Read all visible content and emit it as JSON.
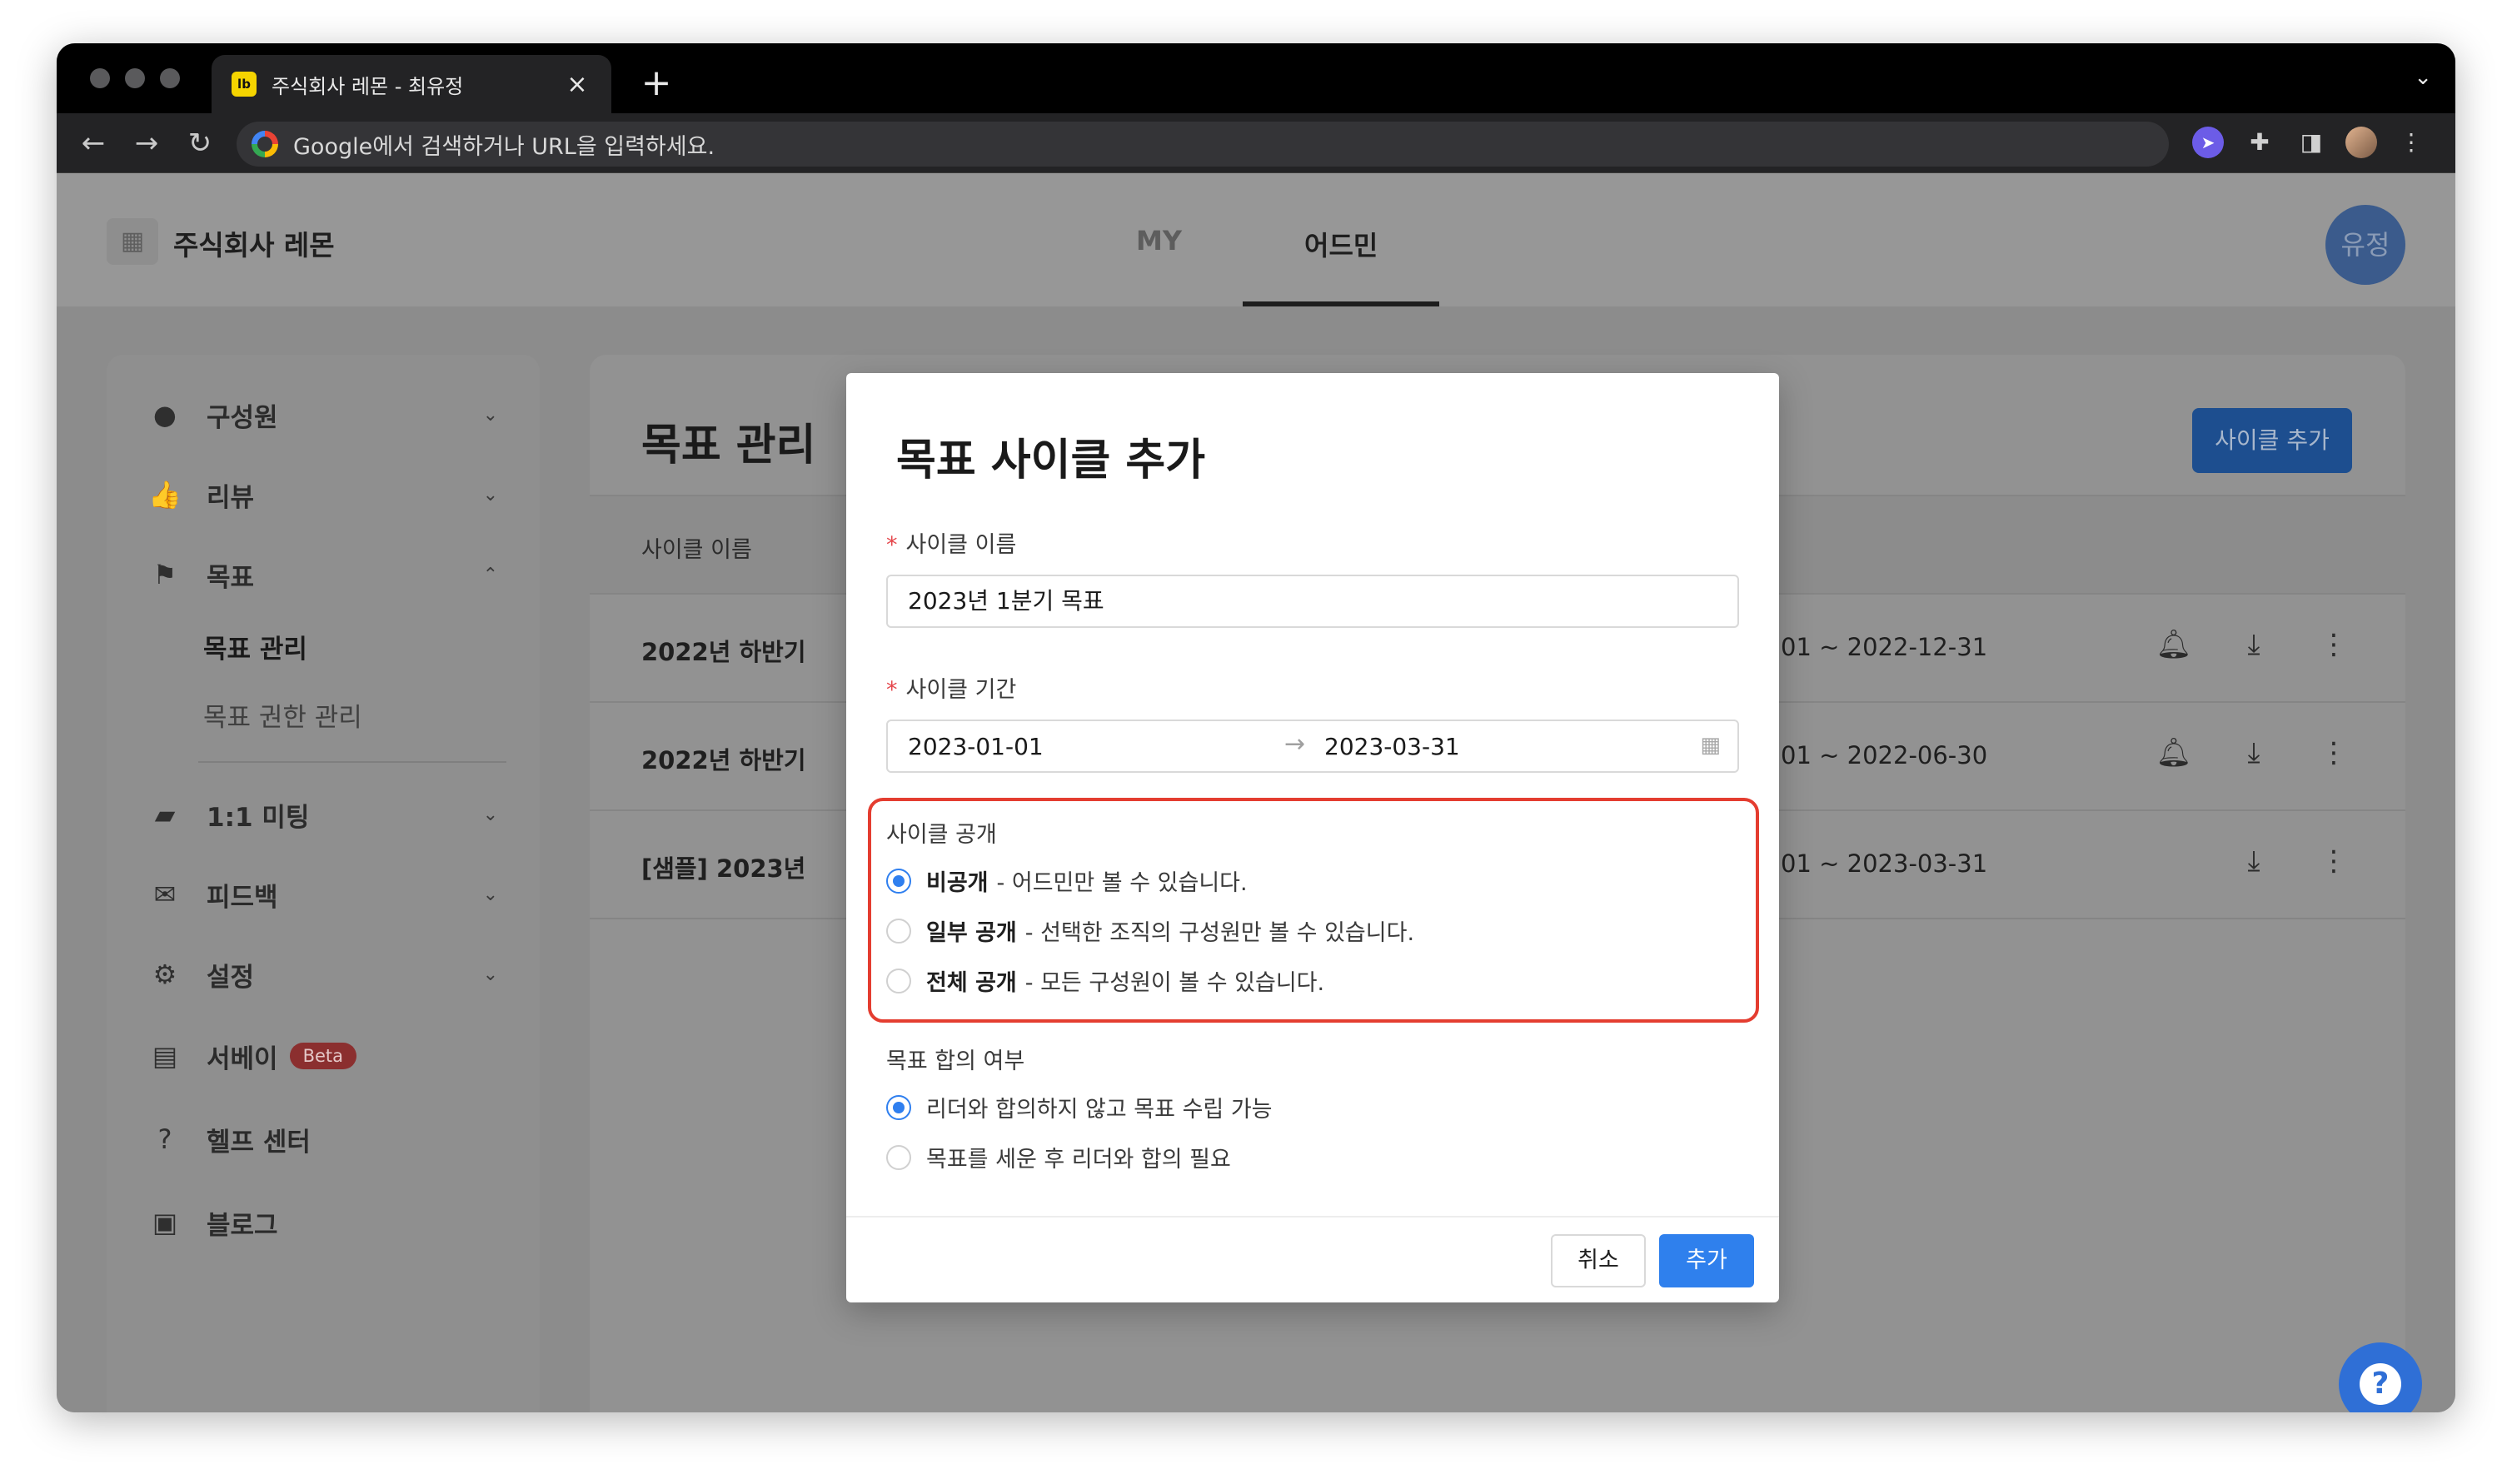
{
  "browser": {
    "tab_title": "주식회사 레몬 - 최유정",
    "tab_favicon": "lb",
    "omnibox_placeholder": "Google에서 검색하거나 URL을 입력하세요."
  },
  "header": {
    "company_name": "주식회사 레몬",
    "tabs": [
      {
        "label": "MY",
        "active": false
      },
      {
        "label": "어드민",
        "active": true
      }
    ],
    "user_avatar": "유정"
  },
  "sidebar": {
    "items": [
      {
        "label": "구성원",
        "icon": "person-icon",
        "expanded": false
      },
      {
        "label": "리뷰",
        "icon": "thumbs-up-icon",
        "expanded": false
      },
      {
        "label": "목표",
        "icon": "flag-icon",
        "expanded": true
      },
      {
        "label": "1:1 미팅",
        "icon": "chat-icon",
        "expanded": false
      },
      {
        "label": "피드백",
        "icon": "mail-icon",
        "expanded": false
      },
      {
        "label": "설정",
        "icon": "gear-icon",
        "expanded": false
      },
      {
        "label": "서베이",
        "icon": "document-icon",
        "badge": "Beta"
      },
      {
        "label": "헬프 센터",
        "icon": "help-icon"
      },
      {
        "label": "블로그",
        "icon": "book-icon"
      }
    ],
    "sub_items": [
      {
        "label": "목표 관리",
        "active": true
      },
      {
        "label": "목표 권한 관리",
        "active": false
      }
    ]
  },
  "main": {
    "title": "목표 관리",
    "add_button": "사이클 추가",
    "column_name": "사이클 이름",
    "rows": [
      {
        "name": "2022년 하반기",
        "date": "01 ~ 2022-12-31",
        "has_bell": true
      },
      {
        "name": "2022년 하반기",
        "date": "01 ~ 2022-06-30",
        "has_bell": true
      },
      {
        "name": "[샘플] 2023년",
        "date": "01 ~ 2023-03-31",
        "has_bell": false
      }
    ]
  },
  "modal": {
    "title": "목표 사이클 추가",
    "required_mark": "*",
    "name_label": "사이클 이름",
    "name_value": "2023년 1분기 목표",
    "period_label": "사이클 기간",
    "period_start": "2023-01-01",
    "period_end": "2023-03-31",
    "visibility_label": "사이클 공개",
    "visibility_options": [
      {
        "title": "비공개",
        "desc": "- 어드민만 볼 수 있습니다.",
        "selected": true
      },
      {
        "title": "일부 공개",
        "desc": "- 선택한 조직의 구성원만 볼 수 있습니다.",
        "selected": false
      },
      {
        "title": "전체 공개",
        "desc": "- 모든 구성원이 볼 수 있습니다.",
        "selected": false
      }
    ],
    "agreement_label": "목표 합의 여부",
    "agreement_options": [
      {
        "label": "리더와 합의하지 않고 목표 수립 가능",
        "selected": true
      },
      {
        "label": "목표를 세운 후 리더와 합의 필요",
        "selected": false
      }
    ],
    "cancel_label": "취소",
    "submit_label": "추가"
  },
  "colors": {
    "primary": "#2f80ed",
    "highlight_border": "#e43d30",
    "required": "#e5484d"
  }
}
